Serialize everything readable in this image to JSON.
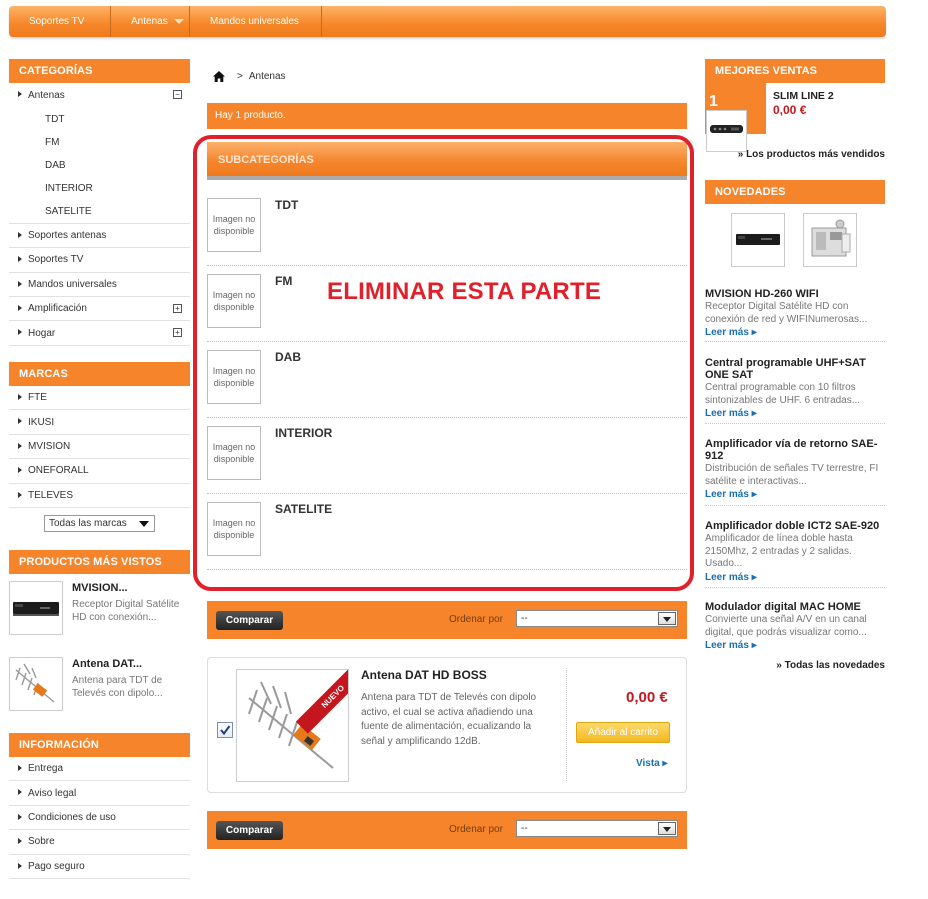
{
  "nav": {
    "items": [
      "Soportes TV",
      "Antenas",
      "Mandos universales"
    ]
  },
  "categories": {
    "title": "CATEGORÍAS",
    "items": [
      {
        "label": "Antenas",
        "toggle": "−"
      },
      {
        "label": "TDT"
      },
      {
        "label": "FM"
      },
      {
        "label": "DAB"
      },
      {
        "label": "INTERIOR"
      },
      {
        "label": "SATELITE"
      },
      {
        "label": "Soportes antenas"
      },
      {
        "label": "Soportes TV"
      },
      {
        "label": "Mandos universales"
      },
      {
        "label": "Amplificación",
        "toggle": "+"
      },
      {
        "label": "Hogar",
        "toggle": "+"
      }
    ]
  },
  "brands": {
    "title": "MARCAS",
    "items": [
      "FTE",
      "IKUSI",
      "MVISION",
      "ONEFORALL",
      "TELEVES"
    ],
    "select_value": "Todas las marcas"
  },
  "most_viewed": {
    "title": "PRODUCTOS MÁS VISTOS",
    "items": [
      {
        "name": "MVISION...",
        "desc": "Receptor Digital Satélite HD con conexión..."
      },
      {
        "name": "Antena DAT...",
        "desc": "Antena para TDT de Televés con dipolo..."
      }
    ]
  },
  "info": {
    "title": "INFORMACIÓN",
    "items": [
      "Entrega",
      "Aviso legal",
      "Condiciones de uso",
      "Sobre",
      "Pago seguro"
    ]
  },
  "breadcrumb": {
    "separator": ">",
    "current": "Antenas"
  },
  "results": {
    "count_text": "Hay 1 producto."
  },
  "subcategories": {
    "title": "SUBCATEGORÍAS",
    "no_image": "Imagen no disponible",
    "items": [
      "TDT",
      "FM",
      "DAB",
      "INTERIOR",
      "SATELITE"
    ]
  },
  "annotation": {
    "text": "ELIMINAR ESTA PARTE",
    "color": "#e0202a"
  },
  "toolbar": {
    "compare_label": "Comparar",
    "order_label": "Ordenar por",
    "order_value": "--"
  },
  "product": {
    "name": "Antena DAT HD BOSS",
    "description": "Antena para TDT de Televés con dipolo activo, el cual se activa añadiendo una fuente de alimentación, ecualizando la señal y amplificando 12dB.",
    "price": "0,00 €",
    "badge": "NUEVO",
    "add_to_cart": "Añadir al carrito",
    "view_label": "Vista",
    "checked": true
  },
  "best_sellers": {
    "title": "MEJORES VENTAS",
    "rank": "1",
    "name": "SLIM LINE 2",
    "price": "0,00 €",
    "link": "» Los productos más vendidos"
  },
  "news": {
    "title": "NOVEDADES",
    "more_label": "Leer más",
    "items": [
      {
        "title": "MVISION HD-260 WIFI",
        "desc": "Receptor Digital Satélite HD con conexión de red y WIFINumerosas..."
      },
      {
        "title": "Central programable UHF+SAT ONE SAT",
        "desc": "Central programable con 10 filtros sintonizables de UHF. 6 entradas..."
      },
      {
        "title": "Amplificador vía de retorno SAE-912",
        "desc": "Distribución de señales TV terrestre, FI satélite e interactivas..."
      },
      {
        "title": "Amplificador doble ICT2 SAE-920",
        "desc": "Amplificador de línea doble hasta 2150Mhz, 2 entradas y 2 salidas. Usado..."
      },
      {
        "title": "Modulador digital MAC HOME",
        "desc": "Convierte una señal A/V en un canal digital, que podrás visualizar como..."
      }
    ],
    "all_link": "» Todas las novedades"
  },
  "colors": {
    "accent": "#f5842b",
    "link": "#1a6fb0",
    "price": "#c4161c"
  }
}
